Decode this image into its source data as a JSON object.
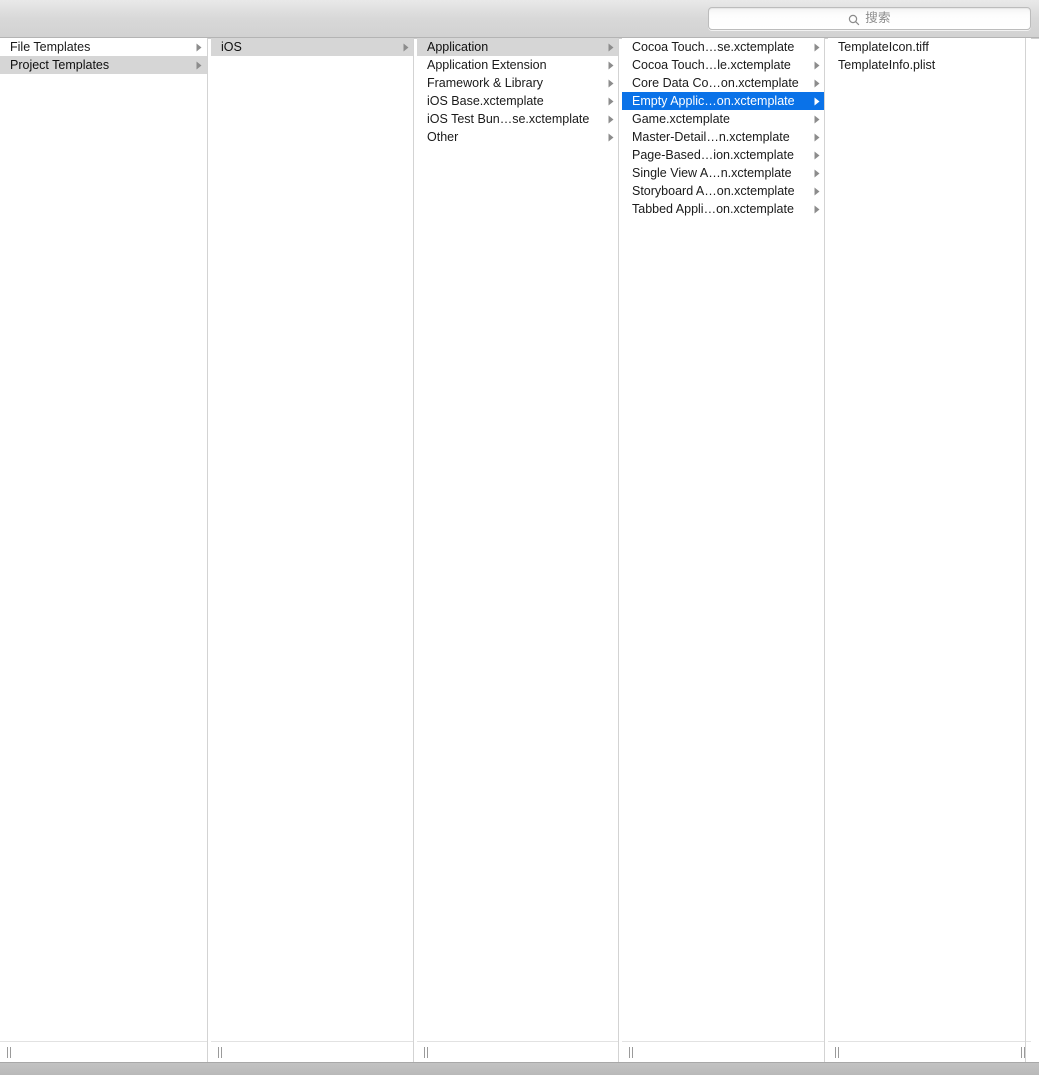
{
  "window": {
    "title": "",
    "accent_color": "#0a72e8",
    "selection_gray": "#d6d6d6"
  },
  "toolbar": {
    "search": {
      "placeholder": "搜索",
      "value": "",
      "icon": "search-icon"
    }
  },
  "browser": {
    "columns": [
      {
        "name": "templates-root",
        "rows": [
          {
            "label": "File Templates",
            "has_children": true,
            "selected": false,
            "selection_style": "none"
          },
          {
            "label": "Project Templates",
            "has_children": true,
            "selected": true,
            "selection_style": "gray"
          }
        ]
      },
      {
        "name": "platform",
        "rows": [
          {
            "label": "iOS",
            "has_children": true,
            "selected": true,
            "selection_style": "gray"
          }
        ]
      },
      {
        "name": "category",
        "rows": [
          {
            "label": "Application",
            "has_children": true,
            "selected": true,
            "selection_style": "gray"
          },
          {
            "label": "Application Extension",
            "has_children": true,
            "selected": false,
            "selection_style": "none"
          },
          {
            "label": "Framework & Library",
            "has_children": true,
            "selected": false,
            "selection_style": "none"
          },
          {
            "label": "iOS Base.xctemplate",
            "has_children": true,
            "selected": false,
            "selection_style": "none"
          },
          {
            "label": "iOS Test Bun…se.xctemplate",
            "has_children": true,
            "selected": false,
            "selection_style": "none"
          },
          {
            "label": "Other",
            "has_children": true,
            "selected": false,
            "selection_style": "none"
          }
        ]
      },
      {
        "name": "templates",
        "rows": [
          {
            "label": "Cocoa Touch…se.xctemplate",
            "has_children": true,
            "selected": false,
            "selection_style": "none"
          },
          {
            "label": "Cocoa Touch…le.xctemplate",
            "has_children": true,
            "selected": false,
            "selection_style": "none"
          },
          {
            "label": "Core Data Co…on.xctemplate",
            "has_children": true,
            "selected": false,
            "selection_style": "none"
          },
          {
            "label": "Empty Applic…on.xctemplate",
            "has_children": true,
            "selected": true,
            "selection_style": "blue"
          },
          {
            "label": "Game.xctemplate",
            "has_children": true,
            "selected": false,
            "selection_style": "none"
          },
          {
            "label": "Master-Detail…n.xctemplate",
            "has_children": true,
            "selected": false,
            "selection_style": "none"
          },
          {
            "label": "Page-Based…ion.xctemplate",
            "has_children": true,
            "selected": false,
            "selection_style": "none"
          },
          {
            "label": "Single View A…n.xctemplate",
            "has_children": true,
            "selected": false,
            "selection_style": "none"
          },
          {
            "label": "Storyboard A…on.xctemplate",
            "has_children": true,
            "selected": false,
            "selection_style": "none"
          },
          {
            "label": "Tabbed Appli…on.xctemplate",
            "has_children": true,
            "selected": false,
            "selection_style": "none"
          }
        ]
      },
      {
        "name": "template-contents",
        "rows": [
          {
            "label": "TemplateIcon.tiff",
            "has_children": false,
            "selected": false,
            "selection_style": "none"
          },
          {
            "label": "TemplateInfo.plist",
            "has_children": false,
            "selected": false,
            "selection_style": "none"
          }
        ]
      }
    ]
  }
}
